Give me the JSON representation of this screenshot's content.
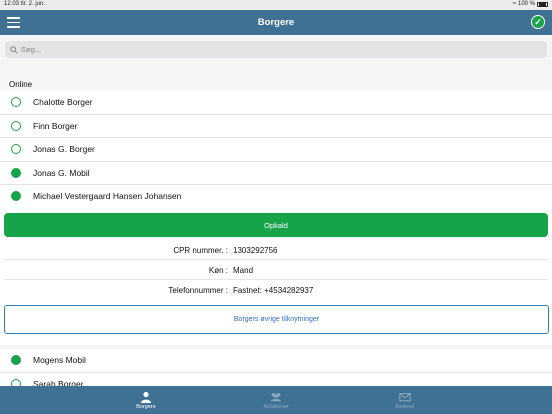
{
  "status_bar": {
    "time_date": "12.03  tir. 2. jun.",
    "battery": "100 %"
  },
  "nav": {
    "title": "Borgere"
  },
  "search": {
    "placeholder": "Søg..."
  },
  "section": {
    "title": "Online"
  },
  "citizens": [
    {
      "name": "Chalotte Borger",
      "online": false
    },
    {
      "name": "Finn Borger",
      "online": false
    },
    {
      "name": "Jonas G. Borger",
      "online": false
    },
    {
      "name": "Jonas G. Mobil",
      "online": true
    },
    {
      "name": "Michael Vestergaard Hansen Johansen",
      "online": true
    }
  ],
  "details": {
    "call_label": "Opkald",
    "cpr_label": "CPR nummer. :",
    "cpr_value": "1303292756",
    "gender_label": "Køn :",
    "gender_value": "Mand",
    "phone_label": "Telefonnummer :",
    "phone_value": "Fastnet: +4534282937",
    "relations_label": "Borgers øvrige tilknytninger"
  },
  "citizens_after": [
    {
      "name": "Mogens Mobil",
      "online": true
    },
    {
      "name": "Sarah Borger",
      "online": false
    }
  ],
  "tabs": [
    {
      "label": "Borgere",
      "icon": "person-icon",
      "active": true
    },
    {
      "label": "Relationer",
      "icon": "group-icon",
      "active": false
    },
    {
      "label": "Besked",
      "icon": "envelope-icon",
      "active": false
    }
  ],
  "colors": {
    "nav_blue": "#3f7195",
    "online_green": "#16a34a",
    "link_blue": "#2f6fc0"
  }
}
